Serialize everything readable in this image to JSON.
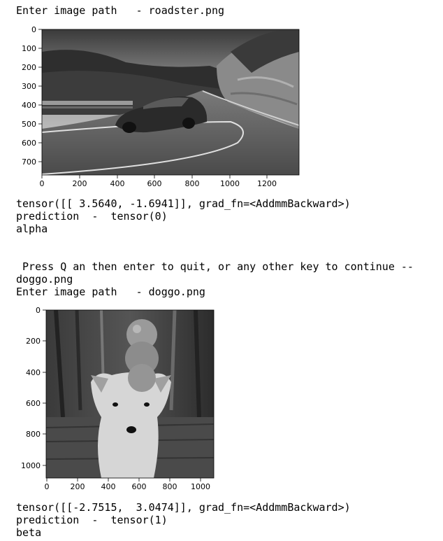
{
  "output": {
    "lines": [
      "Enter image path   - roadster.png",
      "tensor([[ 3.5640, -1.6941]], grad_fn=<AddmmBackward>)",
      "prediction  -  tensor(0)",
      "alpha",
      " Press Q an then enter to quit, or any other key to continue --",
      "doggo.png",
      "Enter image path   - doggo.png",
      "tensor([[-2.7515,  3.0474]], grad_fn=<AddmmBackward>)",
      "prediction  -  tensor(1)",
      "beta"
    ]
  },
  "plots": [
    {
      "image_name": "roadster-car-photo",
      "x_ticks": [
        "0",
        "200",
        "400",
        "600",
        "800",
        "1000",
        "1200"
      ],
      "y_ticks": [
        "0",
        "100",
        "200",
        "300",
        "400",
        "500",
        "600",
        "700"
      ]
    },
    {
      "image_name": "shiba-dog-photo",
      "x_ticks": [
        "0",
        "200",
        "400",
        "600",
        "800",
        "1000"
      ],
      "y_ticks": [
        "0",
        "200",
        "400",
        "600",
        "800",
        "1000"
      ]
    }
  ]
}
